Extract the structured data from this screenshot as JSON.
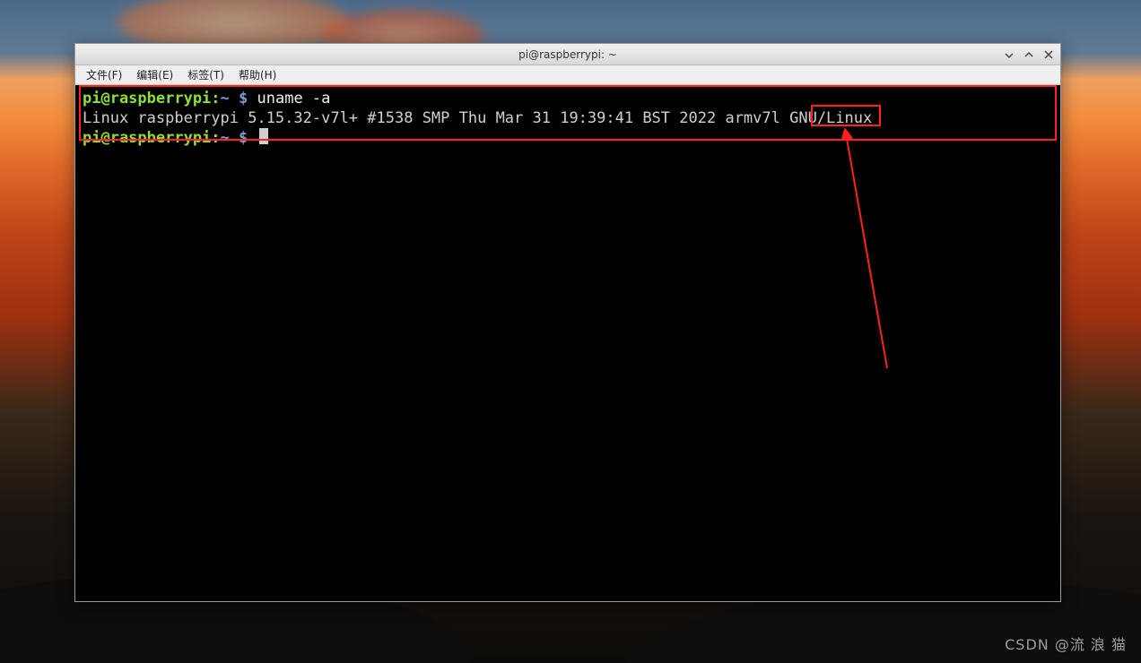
{
  "window": {
    "title": "pi@raspberrypi: ~"
  },
  "menubar": {
    "file": "文件(F)",
    "edit": "编辑(E)",
    "tabs": "标签(T)",
    "help": "帮助(H)"
  },
  "terminal": {
    "prompt_user": "pi@raspberrypi",
    "prompt_sep": ":",
    "prompt_path": "~",
    "prompt_dollar": " $ ",
    "command1": "uname -a",
    "output1_pre": "Linux raspberrypi 5.15.32-v7l+ #1538 SMP Thu Mar 31 19:39:41 BST 2022 ",
    "output1_hilite": "armv7l",
    "output1_post": " GNU/Linux"
  },
  "watermark": "CSDN @流 浪 猫",
  "colors": {
    "annotation_red": "#ff2020",
    "prompt_green": "#8ae234",
    "prompt_blue": "#729fcf"
  }
}
